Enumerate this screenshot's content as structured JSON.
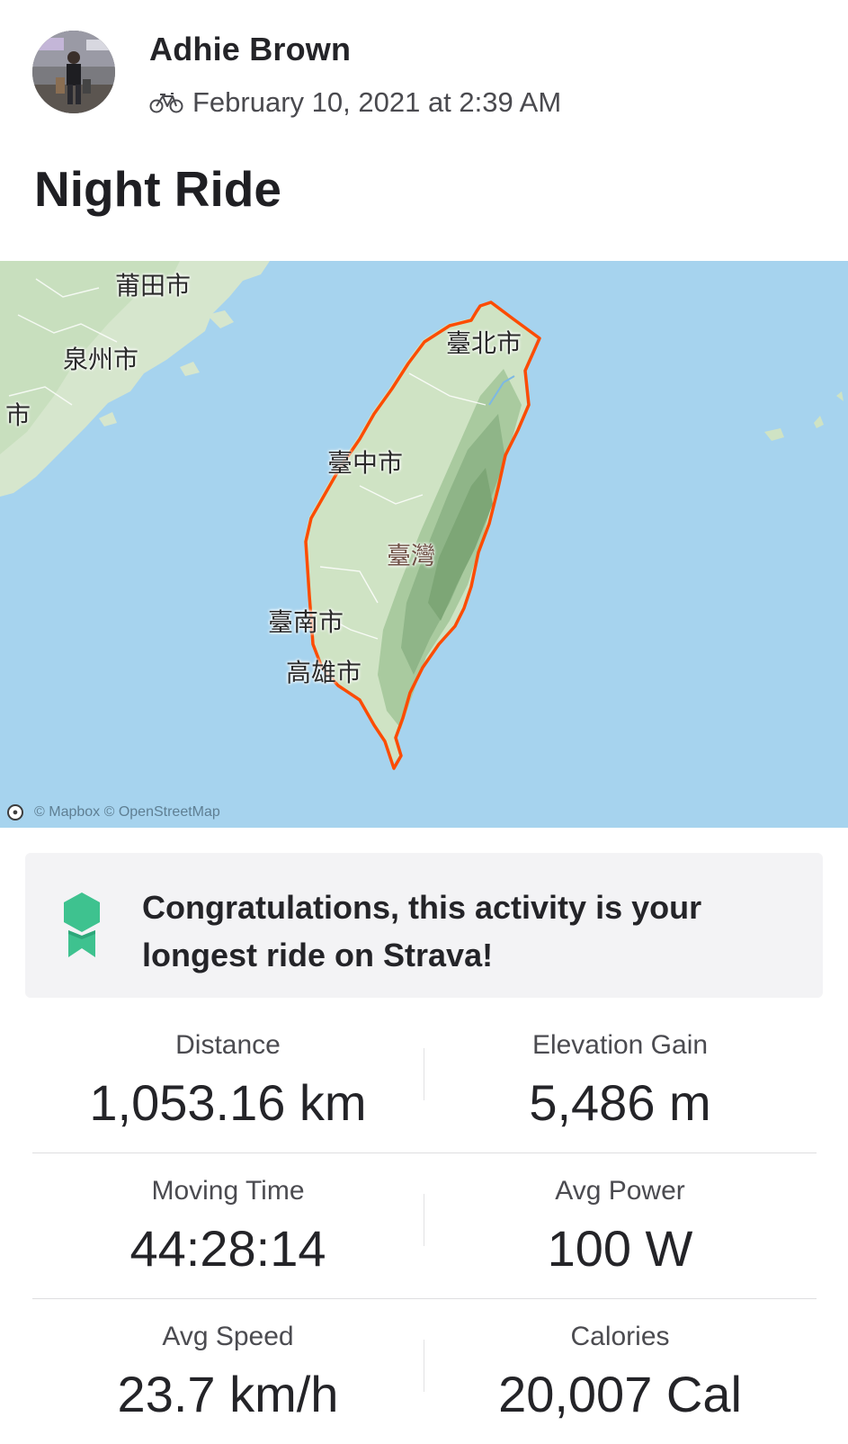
{
  "athlete": {
    "name": "Adhie Brown",
    "activity_icon": "bike-icon",
    "date": "February 10, 2021 at 2:39 AM"
  },
  "activity": {
    "title": "Night Ride"
  },
  "map": {
    "labels": {
      "putian": "莆田市",
      "quanzhou": "泉州市",
      "city_edge": "市",
      "taipei": "臺北市",
      "taichung": "臺中市",
      "taiwan": "臺灣",
      "tainan": "臺南市",
      "kaohsiung": "高雄市"
    },
    "attribution": "© Mapbox © OpenStreetMap",
    "colors": {
      "sea": "#a6d3ee",
      "route": "#fc4c02",
      "land": "#cfe3c4",
      "mountain": "#8fb588"
    }
  },
  "achievement": {
    "icon": "award-ribbon-icon",
    "message": "Congratulations, this activity is your longest ride on Strava!",
    "color": "#3ec28f"
  },
  "stats": [
    {
      "label": "Distance",
      "value": "1,053.16 km"
    },
    {
      "label": "Elevation Gain",
      "value": "5,486 m"
    },
    {
      "label": "Moving Time",
      "value": "44:28:14"
    },
    {
      "label": "Avg Power",
      "value": "100 W"
    },
    {
      "label": "Avg Speed",
      "value": "23.7 km/h"
    },
    {
      "label": "Calories",
      "value": "20,007 Cal"
    }
  ]
}
